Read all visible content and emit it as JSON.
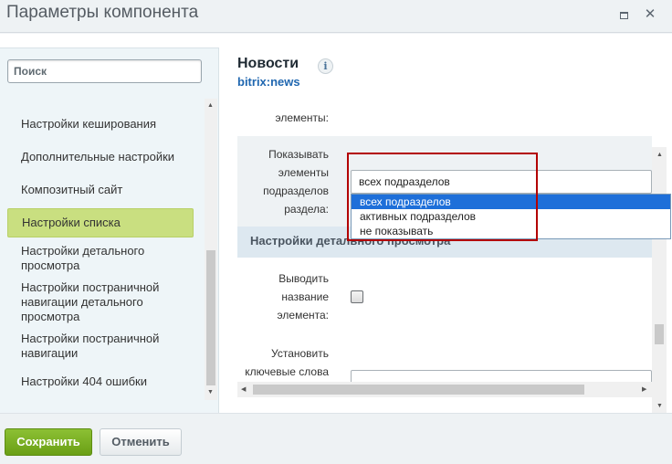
{
  "window": {
    "title": "Параметры компонента",
    "maximize_icon": "maximize-icon",
    "close_glyph": "✕"
  },
  "sidebar": {
    "search_placeholder": "Поиск",
    "items": [
      {
        "label": "Настройки кеширования",
        "active": false
      },
      {
        "label": "Дополнительные настройки",
        "active": false
      },
      {
        "label": "Композитный сайт",
        "active": false
      },
      {
        "label": "Настройки списка",
        "active": true
      },
      {
        "label": "Настройки детального просмотра",
        "active": false
      },
      {
        "label": "Настройки постраничной навигации детального просмотра",
        "active": false
      },
      {
        "label": "Настройки постраничной навигации",
        "active": false
      },
      {
        "label": "Настройки 404 ошибки",
        "active": false
      }
    ]
  },
  "component": {
    "name": "Новости",
    "code": "bitrix:news",
    "info_glyph": "i"
  },
  "form": {
    "prev_label_tail": "элементы:",
    "show_subsection_label": "Показывать элементы подразделов раздела:",
    "show_subsection_value": "всех подразделов",
    "dropdown_options": [
      "всех подразделов",
      "активных подразделов",
      "не показывать"
    ],
    "detail_section_title": "Настройки детального просмотра",
    "show_element_name_label": "Выводить название элемента:",
    "set_keywords_label": "Установить ключевые слова"
  },
  "footer": {
    "save_label": "Сохранить",
    "cancel_label": "Отменить"
  },
  "colors": {
    "active_item": "#c9df80",
    "save_button": "#7bb024",
    "highlight_border": "#b30000",
    "selected_option": "#1e6fd9",
    "link": "#2067b0"
  }
}
